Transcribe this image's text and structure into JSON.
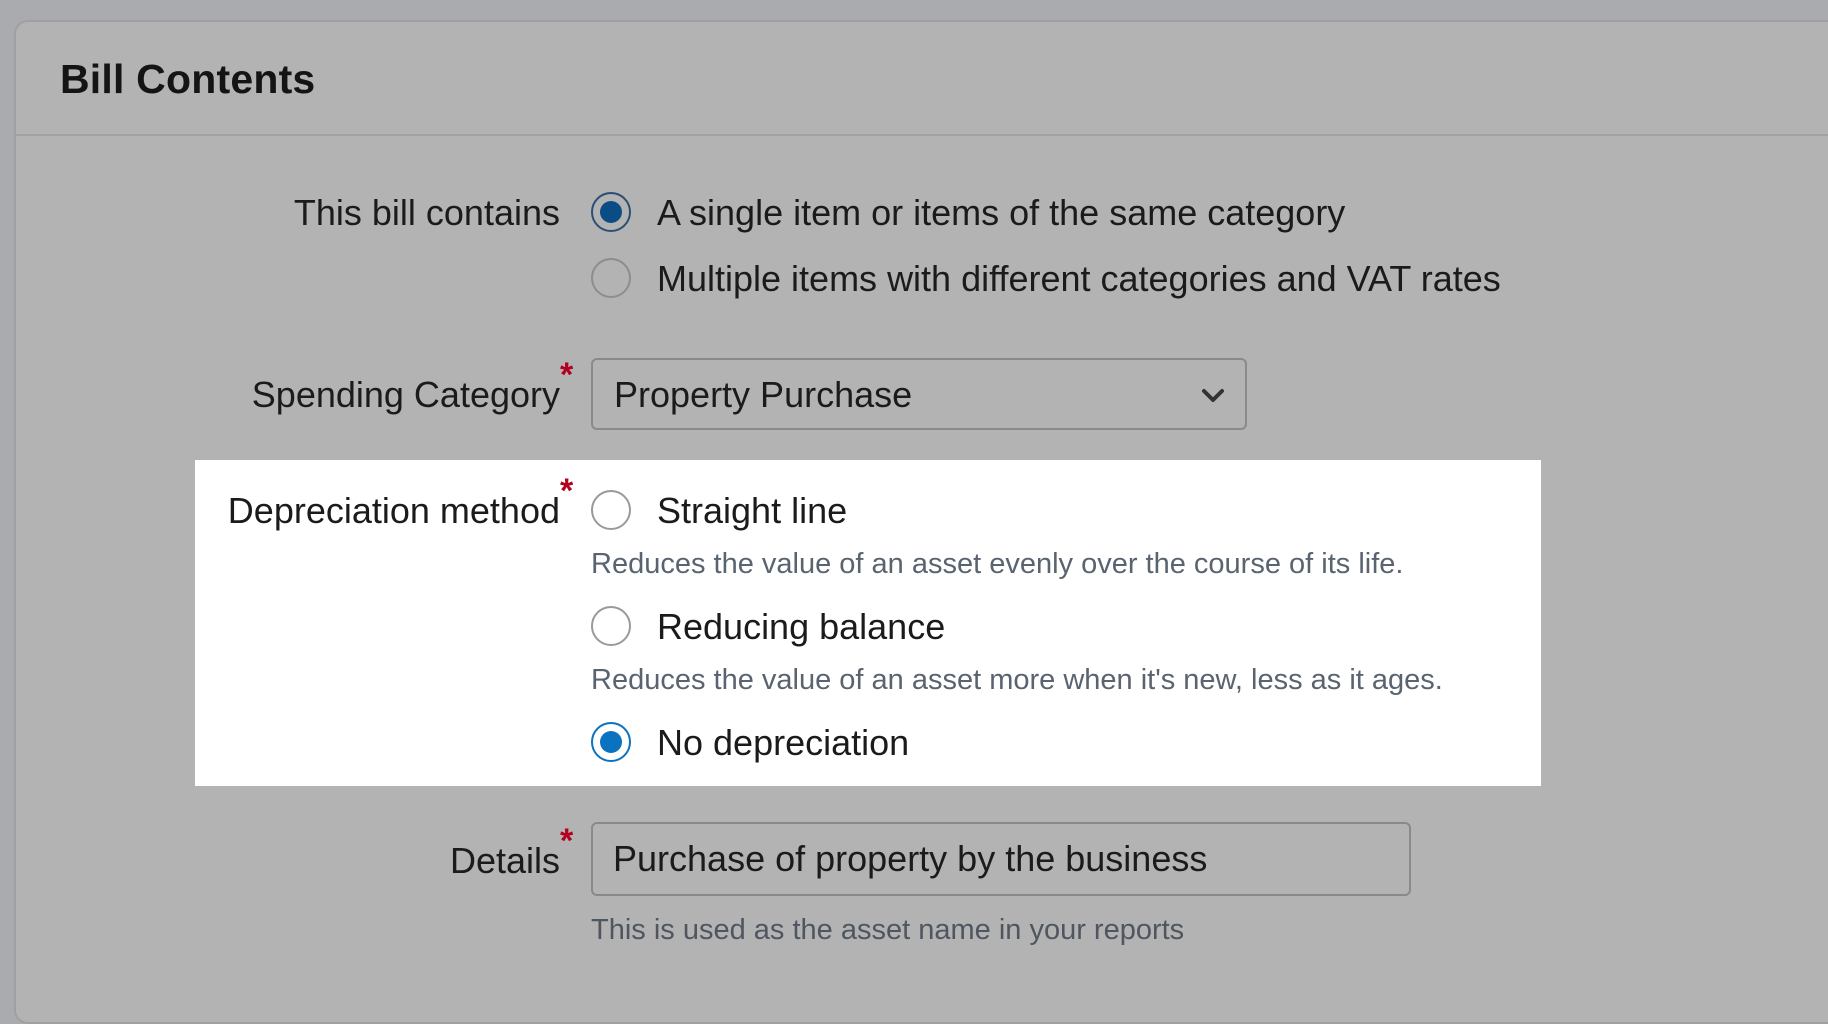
{
  "header": {
    "title": "Bill Contents"
  },
  "bill_contains": {
    "label": "This bill contains",
    "options": [
      {
        "label": "A single item or items of the same category",
        "selected": true
      },
      {
        "label": "Multiple items with different categories and VAT rates",
        "selected": false
      }
    ]
  },
  "spending_category": {
    "label": "Spending Category",
    "required_mark": "*",
    "value": "Property Purchase",
    "icon": "chevron-down-icon"
  },
  "depreciation": {
    "label": "Depreciation method",
    "required_mark": "*",
    "options": [
      {
        "label": "Straight line",
        "hint": "Reduces the value of an asset evenly over the course of its life.",
        "selected": false
      },
      {
        "label": "Reducing balance",
        "hint": "Reduces the value of an asset more when it's new, less as it ages.",
        "selected": false
      },
      {
        "label": "No depreciation",
        "selected": true
      }
    ]
  },
  "details": {
    "label": "Details",
    "required_mark": "*",
    "value": "Purchase of property by the business",
    "hint": "This is used as the asset name in your reports"
  },
  "colors": {
    "accent": "#0b72c0",
    "required": "#b2001e",
    "overlay": "#b3b3b3",
    "highlight": "#ffffff"
  }
}
